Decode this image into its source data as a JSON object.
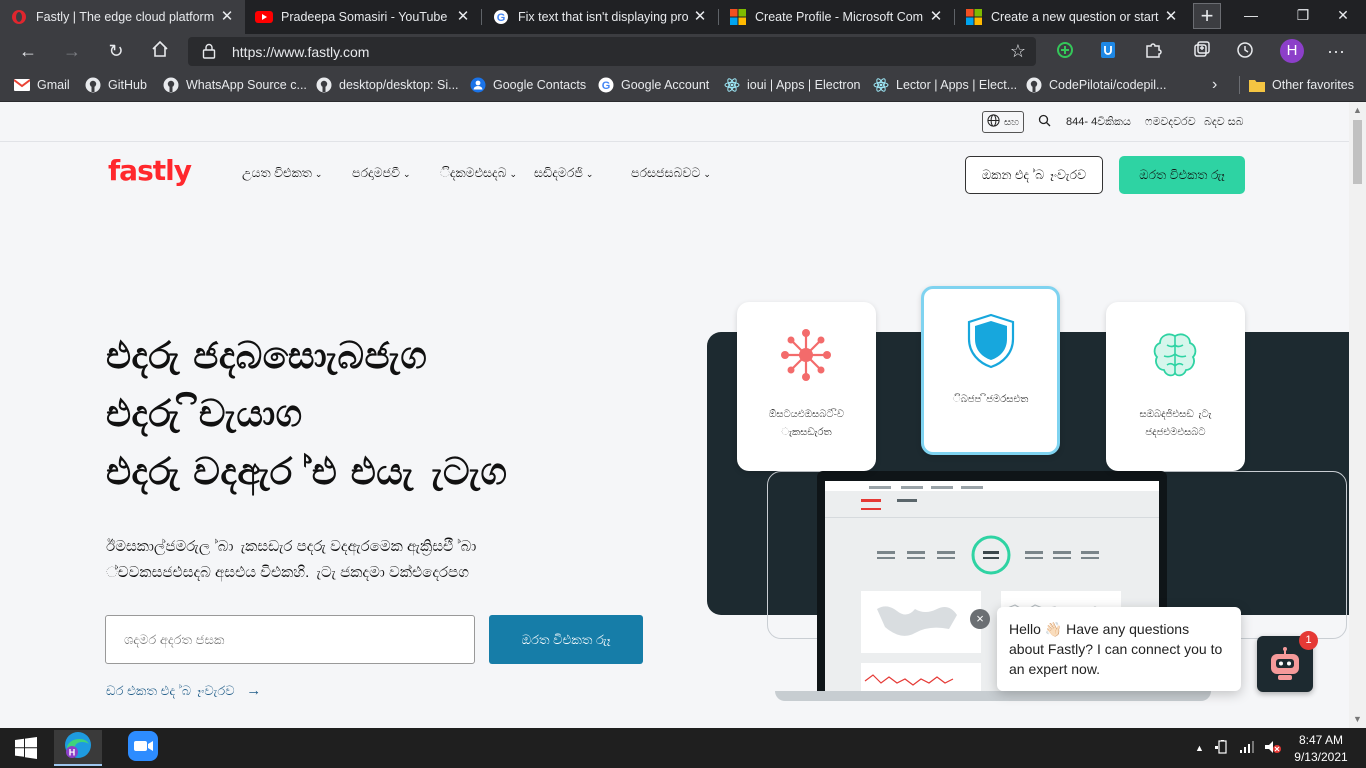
{
  "browser": {
    "tabs": [
      {
        "title": "Fastly | The edge cloud platform",
        "icon": "opera-icon",
        "active": true
      },
      {
        "title": "Pradeepa Somasiri - YouTube",
        "icon": "youtube-icon",
        "active": false
      },
      {
        "title": "Fix text that isn't displaying prop",
        "icon": "google-icon",
        "active": false
      },
      {
        "title": "Create Profile - Microsoft Comm",
        "icon": "microsoft-icon",
        "active": false
      },
      {
        "title": "Create a new question or start a",
        "icon": "microsoft-icon",
        "active": false
      }
    ],
    "new_tab_label": "+",
    "url": "https://www.fastly.com",
    "bookmarks": [
      {
        "label": "Gmail",
        "icon": "gmail-icon"
      },
      {
        "label": "GitHub",
        "icon": "github-icon"
      },
      {
        "label": "WhatsApp Source c...",
        "icon": "github-icon"
      },
      {
        "label": "desktop/desktop: Si...",
        "icon": "github-icon"
      },
      {
        "label": "Google Contacts",
        "icon": "contacts-icon"
      },
      {
        "label": "Google Account",
        "icon": "google-icon"
      },
      {
        "label": "ioui | Apps | Electron",
        "icon": "electron-icon"
      },
      {
        "label": "Lector | Apps | Elect...",
        "icon": "electron-icon"
      },
      {
        "label": "CodePilotai/codepil...",
        "icon": "github-icon"
      }
    ],
    "other_favorites": "Other favorites",
    "profile_initial": "H"
  },
  "site": {
    "utility": {
      "lang_label": "සහ",
      "phone": "844- 4විකිකය",
      "link1": "ෆමවදවරව",
      "link2": "බදව සබ"
    },
    "logo": "fastly",
    "nav": [
      "උයත විඑකත",
      "පරදාමජවී",
      "ිදකමඑසදබ",
      "සඩිදමරජි",
      "පරසජසබවට"
    ],
    "btn_outline": "ඔකන එද ්බ ෑංවැරව",
    "btn_green": "ඔරත විඑකත රුෑ",
    "hero_lines": [
      "එදරු ජදබසොැබජැග",
      "එදරු ිචැයාග",
      "එදරු වදඇර ්එ එයැ ැටැග"
    ],
    "hero_sub": [
      "ඊමසකාල්ජමරුල ්බා ැකසඩැර පදරු වදඇරමෙක ඇක්‍රිසඑී ්බා",
      "්චවකසජඑසදබ අසඑය විඑකහි. ැටැ ජකදමා වක්එදෙරපග"
    ],
    "email_placeholder": "ශදමර අදරත ජසක",
    "cta": "ඔරත විඑකත රුෑ",
    "demo_link": "ඩර එකත එද ්බ ෑංවැරව",
    "demo_arrow": "→",
    "cards": [
      {
        "label_lines": [
          "ඕසටයඑඔසබට-ිව",
          "ැකසඩැරත"
        ],
        "icon": "network-icon",
        "accent": "#f36b6b"
      },
      {
        "label_lines": [
          "ිබජප ිජමරසඑත"
        ],
        "icon": "shield-icon",
        "accent": "#17a7dd"
      },
      {
        "label_lines": [
          "සඔබදජිඑසඩ ැටැ",
          "ජදජඑමඑසබට"
        ],
        "icon": "brain-icon",
        "accent": "#2ed3a3"
      }
    ],
    "chat": {
      "message_lines": [
        "Hello 👋🏻 Have any questions",
        "about Fastly? I can connect you to",
        "an expert now."
      ],
      "badge": "1",
      "close": "×"
    }
  },
  "taskbar": {
    "time": "8:47 AM",
    "date": "9/13/2021"
  },
  "colors": {
    "brand_red": "#ff282d",
    "brand_green": "#2ed3a3",
    "cta_blue": "#167da8",
    "panel_dark": "#1d2a30"
  }
}
